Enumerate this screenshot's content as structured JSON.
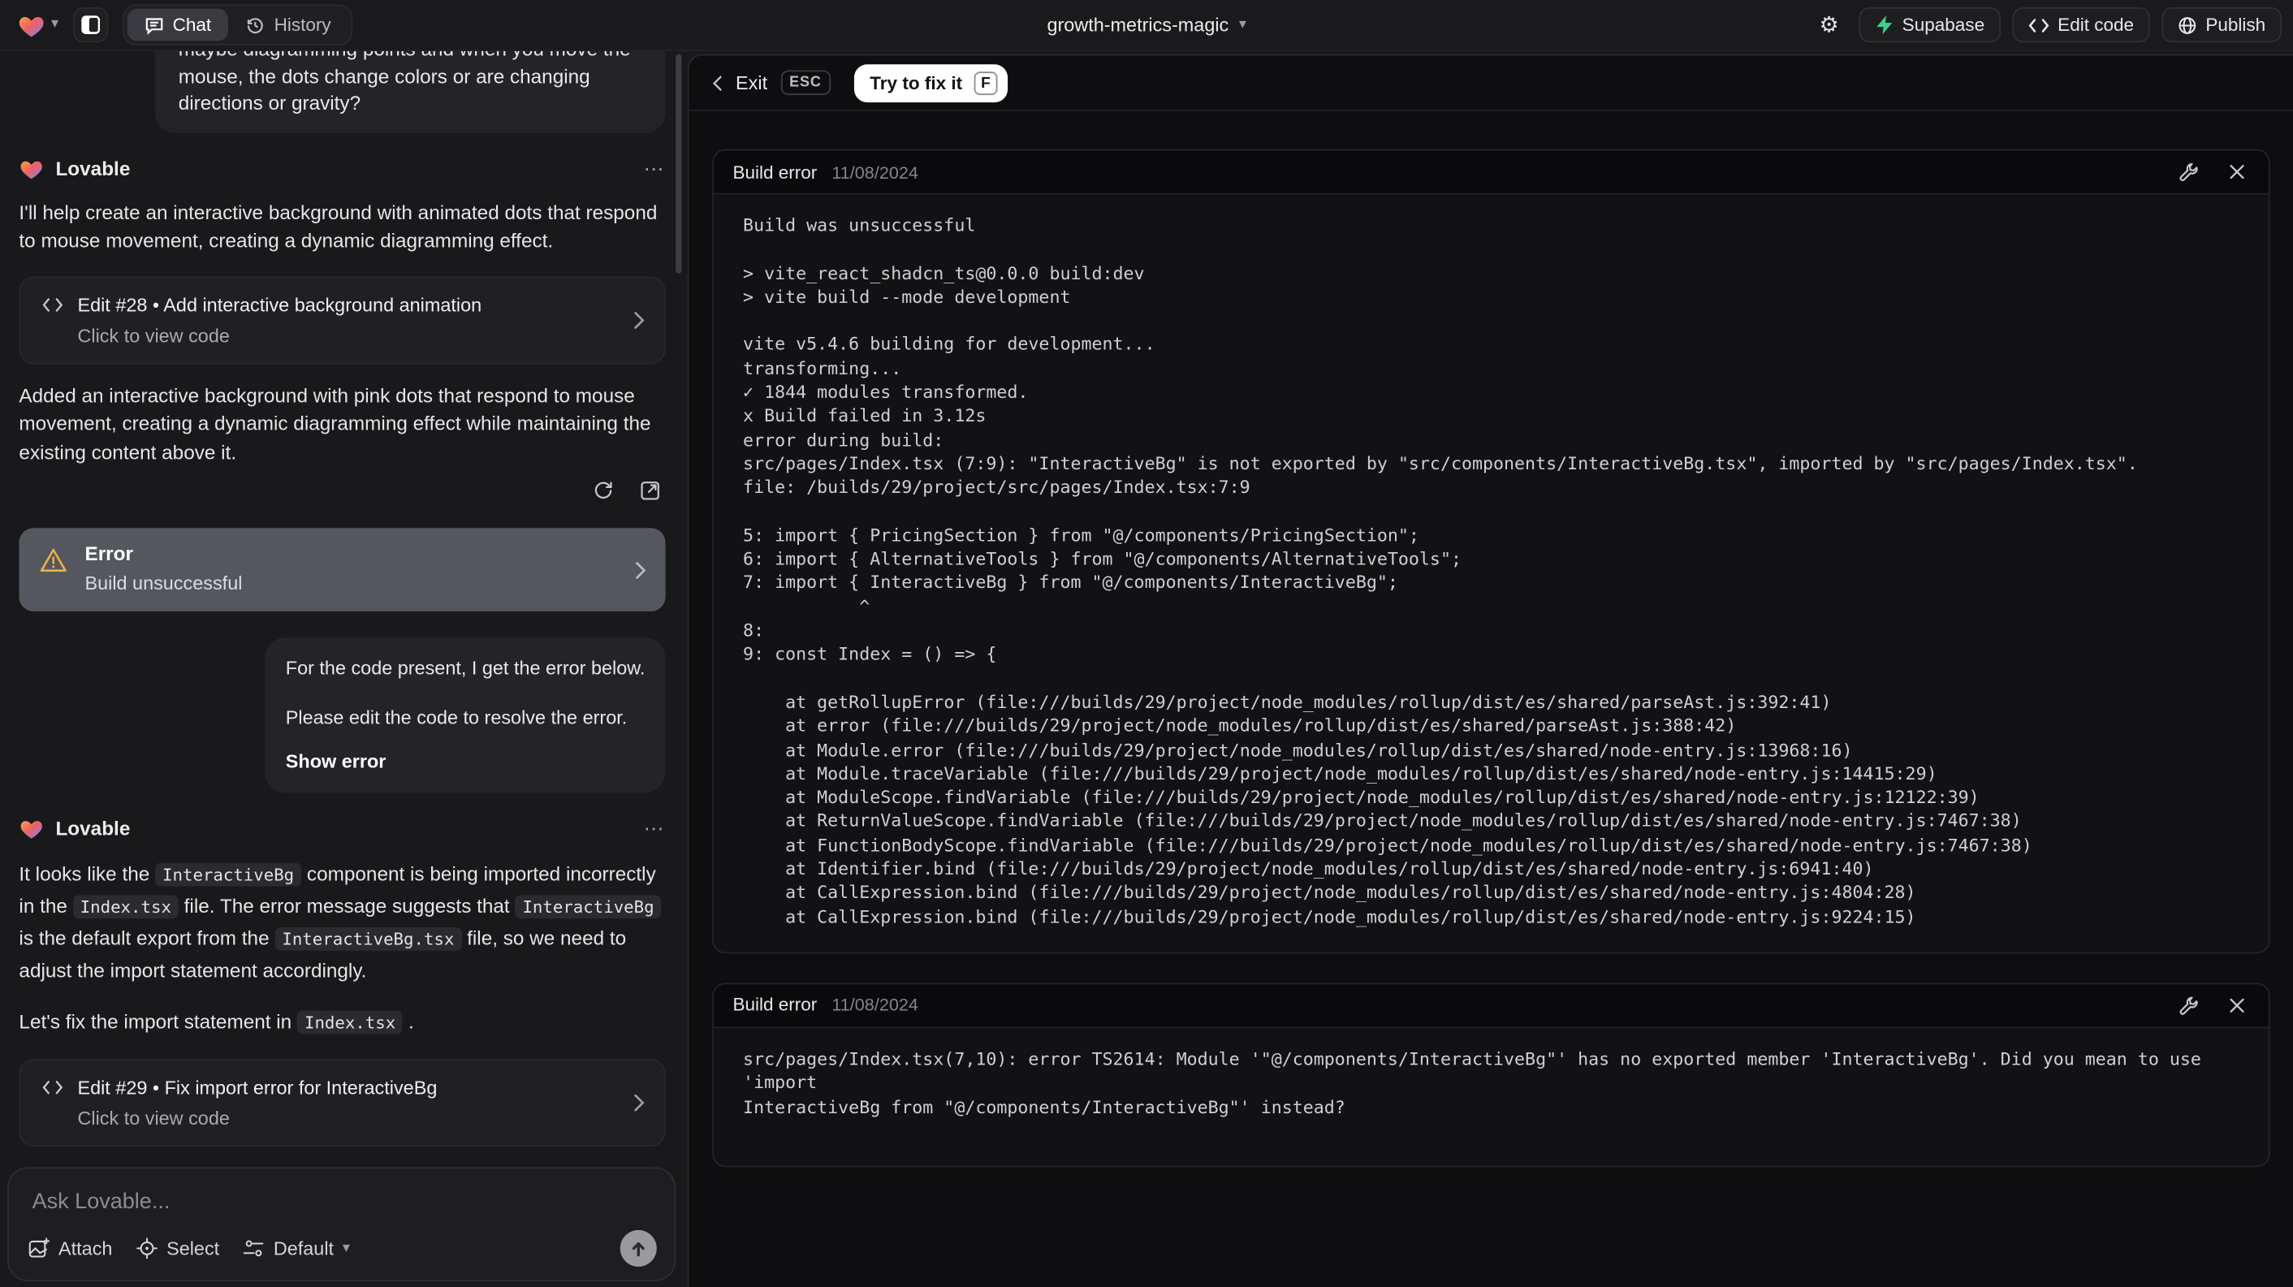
{
  "colors": {
    "supabase_green": "#3ecf8e",
    "warning_yellow": "#e6b349",
    "error_card_bg": "#55575e",
    "fix_button_bg": "#ffffff"
  },
  "header": {
    "tabs": {
      "chat": "Chat",
      "history": "History"
    },
    "project_title": "growth-metrics-magic",
    "buttons": {
      "supabase": "Supabase",
      "edit_code": "Edit code",
      "publish": "Publish"
    }
  },
  "chat": {
    "assistant_name": "Lovable",
    "more_menu": "⋯",
    "user_message_1": "maybe diagramming points and when you move the mouse, the dots change colors or are changing directions or gravity?",
    "msg2": {
      "para1": "I'll help create an interactive background with animated dots that respond to mouse movement, creating a dynamic diagramming effect.",
      "edit_card": {
        "title": "Edit #28 • Add interactive background animation",
        "subtitle": "Click to view code"
      },
      "para2": "Added an interactive background with pink dots that respond to mouse movement, creating a dynamic diagramming effect while maintaining the existing content above it.",
      "error_card": {
        "title": "Error",
        "subtitle": "Build unsuccessful"
      }
    },
    "user_message_2": {
      "line1": "For the code present, I get the error below.",
      "line2": "Please edit the code to resolve the error.",
      "link": "Show error"
    },
    "msg4": {
      "p1": [
        "It looks like the ",
        "InteractiveBg",
        " component is being imported incorrectly in the ",
        "Index.tsx",
        " file. The error message suggests that ",
        "InteractiveBg",
        " is the default export from the ",
        "InteractiveBg.tsx",
        " file, so we need to adjust the import statement accordingly."
      ],
      "p2": [
        "Let's fix the import statement in ",
        "Index.tsx",
        " ."
      ],
      "edit_card": {
        "title": "Edit #29 • Fix import error for InteractiveBg",
        "subtitle": "Click to view code"
      }
    },
    "input": {
      "placeholder": "Ask Lovable...",
      "attach": "Attach",
      "select": "Select",
      "mode": "Default"
    }
  },
  "preview": {
    "toolbar": {
      "exit": "Exit",
      "esc_key": "ESC",
      "fix_button": "Try to fix it",
      "fix_key": "F"
    },
    "panel1": {
      "title": "Build error",
      "date": "11/08/2024",
      "log": "Build was unsuccessful\n\n> vite_react_shadcn_ts@0.0.0 build:dev\n> vite build --mode development\n\nvite v5.4.6 building for development...\ntransforming...\n✓ 1844 modules transformed.\nx Build failed in 3.12s\nerror during build:\nsrc/pages/Index.tsx (7:9): \"InteractiveBg\" is not exported by \"src/components/InteractiveBg.tsx\", imported by \"src/pages/Index.tsx\".\nfile: /builds/29/project/src/pages/Index.tsx:7:9\n\n5: import { PricingSection } from \"@/components/PricingSection\";\n6: import { AlternativeTools } from \"@/components/AlternativeTools\";\n7: import { InteractiveBg } from \"@/components/InteractiveBg\";\n           ^\n8:\n9: const Index = () => {\n\n    at getRollupError (file:///builds/29/project/node_modules/rollup/dist/es/shared/parseAst.js:392:41)\n    at error (file:///builds/29/project/node_modules/rollup/dist/es/shared/parseAst.js:388:42)\n    at Module.error (file:///builds/29/project/node_modules/rollup/dist/es/shared/node-entry.js:13968:16)\n    at Module.traceVariable (file:///builds/29/project/node_modules/rollup/dist/es/shared/node-entry.js:14415:29)\n    at ModuleScope.findVariable (file:///builds/29/project/node_modules/rollup/dist/es/shared/node-entry.js:12122:39)\n    at ReturnValueScope.findVariable (file:///builds/29/project/node_modules/rollup/dist/es/shared/node-entry.js:7467:38)\n    at FunctionBodyScope.findVariable (file:///builds/29/project/node_modules/rollup/dist/es/shared/node-entry.js:7467:38)\n    at Identifier.bind (file:///builds/29/project/node_modules/rollup/dist/es/shared/node-entry.js:6941:40)\n    at CallExpression.bind (file:///builds/29/project/node_modules/rollup/dist/es/shared/node-entry.js:4804:28)\n    at CallExpression.bind (file:///builds/29/project/node_modules/rollup/dist/es/shared/node-entry.js:9224:15)"
    },
    "panel2": {
      "title": "Build error",
      "date": "11/08/2024",
      "log": "src/pages/Index.tsx(7,10): error TS2614: Module '\"@/components/InteractiveBg\"' has no exported member 'InteractiveBg'. Did you mean to use 'import\nInteractiveBg from \"@/components/InteractiveBg\"' instead?"
    }
  }
}
